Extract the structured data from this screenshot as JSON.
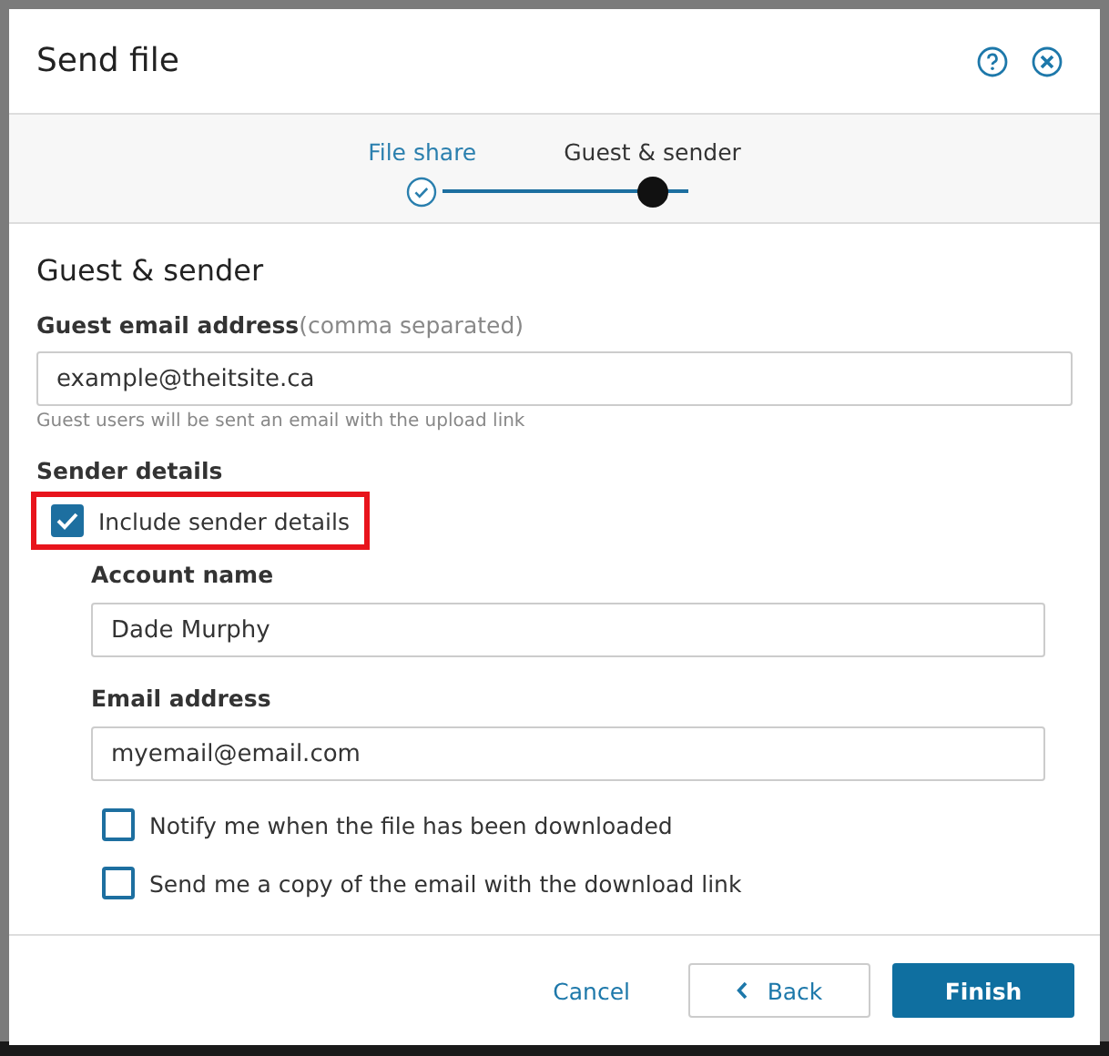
{
  "dialog": {
    "title": "Send file"
  },
  "steps": [
    {
      "label": "File share",
      "completed": true,
      "selected": false
    },
    {
      "label": "Guest & sender",
      "completed": false,
      "selected": true
    }
  ],
  "section_title": "Guest & sender",
  "guest_email": {
    "label": "Guest email address",
    "hint": "(comma separated)",
    "value": "example@theitsite.ca",
    "help": "Guest users will be sent an email with the upload link"
  },
  "sender_details": {
    "label": "Sender details",
    "include": {
      "label": "Include sender details",
      "checked": true,
      "highlighted": true
    },
    "fields": [
      {
        "label": "Account name",
        "value": "Dade Murphy"
      },
      {
        "label": "Email address",
        "value": "myemail@email.com"
      }
    ],
    "options": [
      {
        "label": "Notify me when the file has been downloaded",
        "checked": false
      },
      {
        "label": "Send me a copy of the email with the download link",
        "checked": false
      }
    ]
  },
  "buttons": {
    "cancel": "Cancel",
    "back": "Back",
    "finish": "Finish"
  }
}
